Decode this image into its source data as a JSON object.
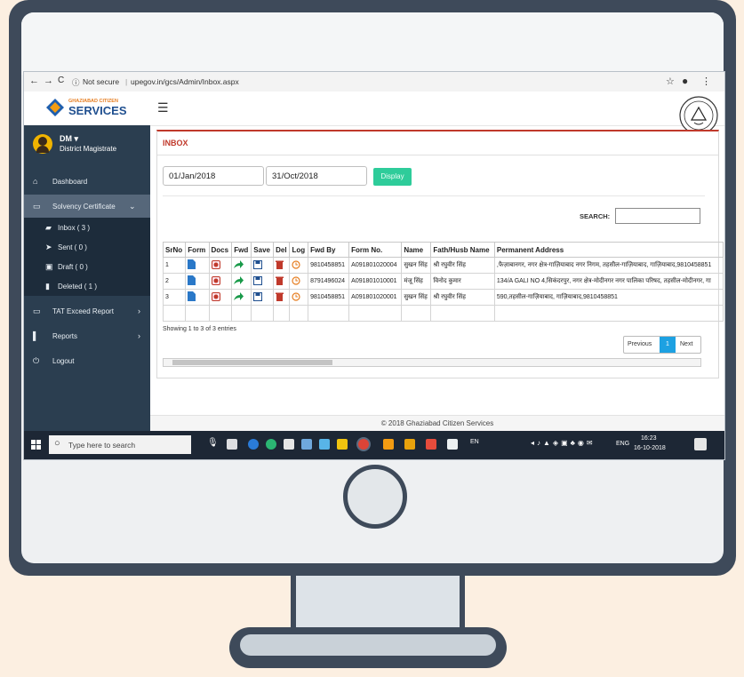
{
  "browser": {
    "security": "Not secure",
    "url": "upegov.in/gcs/Admin/Inbox.aspx"
  },
  "brand": {
    "line1": "GHAZIABAD CITIZEN",
    "line2": "SERVICES"
  },
  "user": {
    "name": "DM ▾",
    "role": "District Magistrate"
  },
  "sidebar": {
    "dashboard": "Dashboard",
    "solvency": "Solvency Certificate",
    "inbox": "Inbox ( 3 )",
    "sent": "Sent ( 0 )",
    "draft": "Draft ( 0 )",
    "deleted": "Deleted ( 1 )",
    "tat": "TAT Exceed Report",
    "reports": "Reports",
    "logout": "Logout"
  },
  "page": {
    "title": "INBOX",
    "from_date": "01/Jan/2018",
    "to_date": "31/Oct/2018",
    "display_label": "Display",
    "search_label": "SEARCH:",
    "showing": "Showing 1 to 3 of 3 entries",
    "prev": "Previous",
    "page_num": "1",
    "next": "Next"
  },
  "table": {
    "headers": [
      "SrNo",
      "Form",
      "Docs",
      "Fwd",
      "Save",
      "Del",
      "Log",
      "Fwd By",
      "Form No.",
      "Name",
      "Fath/Husb Name",
      "Permanent Address"
    ],
    "rows": [
      {
        "srno": "1",
        "fwdby": "9810458851",
        "formno": "A091801020004",
        "name": "सुखन सिंह",
        "father": "श्री रघुवीर सिंह",
        "address": ",फैज़ाबानगर, नगर क्षेत्र-गाज़ियाबाद नगर निगम, तहसील-गाज़ियाबाद, गाज़ियाबाद,9810458851"
      },
      {
        "srno": "2",
        "fwdby": "8791496024",
        "formno": "A091801010001",
        "name": "मंजू सिंह",
        "father": "विनोद कुमार",
        "address": "134/A GALI NO 4,सिकंदरपुर, नगर क्षेत्र-मोदीनगर नगर पालिका परिषद, तहसील-मोदीनगर, गा"
      },
      {
        "srno": "3",
        "fwdby": "9810458851",
        "formno": "A091801020001",
        "name": "सुखन सिंह",
        "father": "श्री रघुवीर सिंह",
        "address": "590,तहसील-गाज़ियाबाद, गाज़ियाबाद,9810458851"
      }
    ]
  },
  "footer": "© 2018 Ghaziabad Citizen Services",
  "taskbar": {
    "search_placeholder": "Type here to search",
    "lang": "ENG",
    "time": "16:23",
    "date": "16-10-2018",
    "en": "EN"
  },
  "colors": {
    "sidebar": "#2b3e50",
    "accent_red": "#c0392b",
    "display_btn": "#2ecc9a",
    "monitor": "#3e4a5a"
  }
}
